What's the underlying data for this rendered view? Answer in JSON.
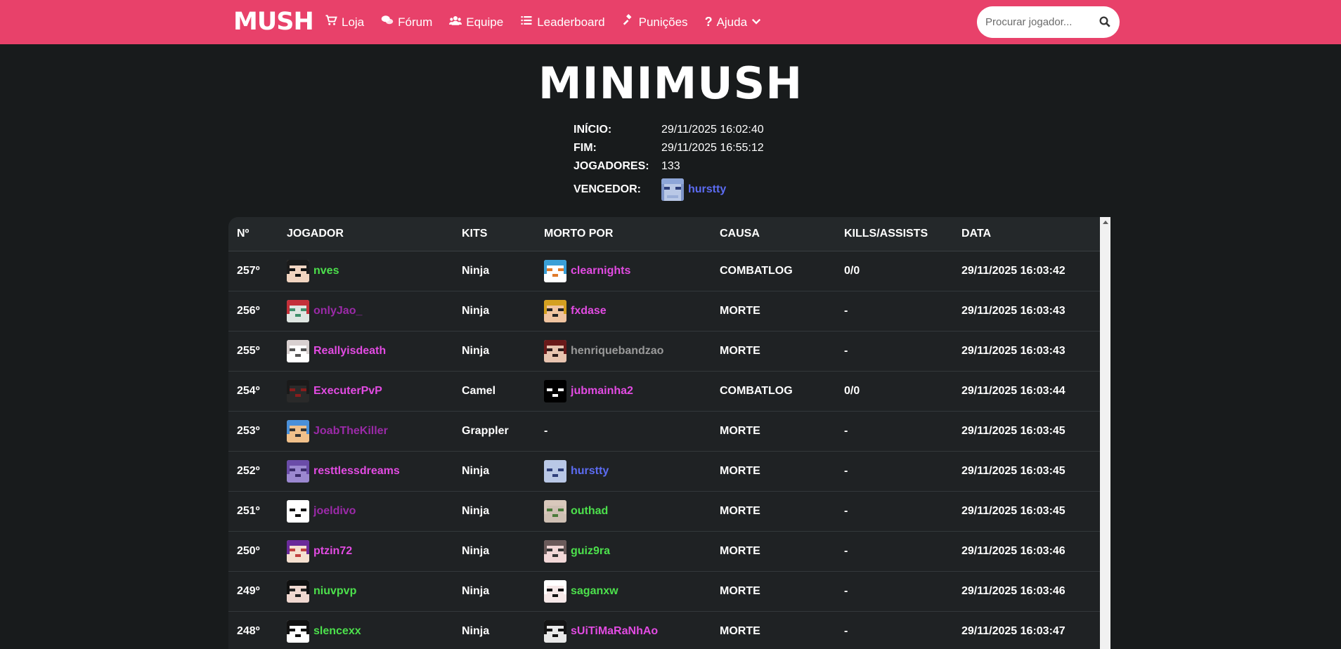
{
  "nav": {
    "logo": "MUSH",
    "items": [
      {
        "label": "Loja",
        "icon": "cart-icon"
      },
      {
        "label": "Fórum",
        "icon": "comments-icon"
      },
      {
        "label": "Equipe",
        "icon": "users-icon"
      },
      {
        "label": "Leaderboard",
        "icon": "list-icon"
      },
      {
        "label": "Punições",
        "icon": "gavel-icon"
      },
      {
        "label": "Ajuda",
        "icon": "question-icon"
      }
    ],
    "search_placeholder": "Procurar jogador..."
  },
  "match": {
    "title": "MINIMUSH",
    "labels": {
      "start": "INÍCIO:",
      "end": "FIM:",
      "players": "JOGADORES:",
      "winner": "VENCEDOR:"
    },
    "start": "29/11/2025 16:02:40",
    "end": "29/11/2025 16:55:12",
    "players": "133",
    "winner": "hurstty"
  },
  "table": {
    "headers": [
      "Nº",
      "JOGADOR",
      "KITS",
      "MORTO POR",
      "CAUSA",
      "KILLS/ASSISTS",
      "DATA"
    ],
    "rows": [
      {
        "pos": "257º",
        "player": "nves",
        "player_color": "#4ce04c",
        "kit": "Ninja",
        "killer": "clearnights",
        "killer_color": "#e24be2",
        "cause": "COMBATLOG",
        "ka": "0/0",
        "date": "29/11/2025 16:03:42"
      },
      {
        "pos": "256º",
        "player": "onlyJao_",
        "player_color": "#9b2aa8",
        "kit": "Ninja",
        "killer": "fxdase",
        "killer_color": "#e24be2",
        "cause": "MORTE",
        "ka": "-",
        "date": "29/11/2025 16:03:43"
      },
      {
        "pos": "255º",
        "player": "Reallyisdeath",
        "player_color": "#e24be2",
        "kit": "Ninja",
        "killer": "henriquebandzao",
        "killer_color": "#9a9a9a",
        "cause": "MORTE",
        "ka": "-",
        "date": "29/11/2025 16:03:43"
      },
      {
        "pos": "254º",
        "player": "ExecuterPvP",
        "player_color": "#e24be2",
        "kit": "Camel",
        "killer": "jubmainha2",
        "killer_color": "#e24be2",
        "cause": "COMBATLOG",
        "ka": "0/0",
        "date": "29/11/2025 16:03:44"
      },
      {
        "pos": "253º",
        "player": "JoabTheKiller",
        "player_color": "#9b2aa8",
        "kit": "Grappler",
        "killer": "-",
        "killer_color": "#ffffff",
        "cause": "MORTE",
        "ka": "-",
        "date": "29/11/2025 16:03:45"
      },
      {
        "pos": "252º",
        "player": "resttlessdreams",
        "player_color": "#e24be2",
        "kit": "Ninja",
        "killer": "hurstty",
        "killer_color": "#5c6cf2",
        "cause": "MORTE",
        "ka": "-",
        "date": "29/11/2025 16:03:45"
      },
      {
        "pos": "251º",
        "player": "joeldivo",
        "player_color": "#9b2aa8",
        "kit": "Ninja",
        "killer": "outhad",
        "killer_color": "#4ce04c",
        "cause": "MORTE",
        "ka": "-",
        "date": "29/11/2025 16:03:45"
      },
      {
        "pos": "250º",
        "player": "ptzin72",
        "player_color": "#e24be2",
        "kit": "Ninja",
        "killer": "guiz9ra",
        "killer_color": "#4ce04c",
        "cause": "MORTE",
        "ka": "-",
        "date": "29/11/2025 16:03:46"
      },
      {
        "pos": "249º",
        "player": "niuvpvp",
        "player_color": "#4ce04c",
        "kit": "Ninja",
        "killer": "saganxw",
        "killer_color": "#4ce04c",
        "cause": "MORTE",
        "ka": "-",
        "date": "29/11/2025 16:03:46"
      },
      {
        "pos": "248º",
        "player": "slencexx",
        "player_color": "#4ce04c",
        "kit": "Ninja",
        "killer": "sUiTiMaRaNhAo",
        "killer_color": "#e24be2",
        "cause": "MORTE",
        "ka": "-",
        "date": "29/11/2025 16:03:47"
      }
    ]
  },
  "colors": {
    "brand": "#e8416a",
    "background": "#181b1c"
  }
}
